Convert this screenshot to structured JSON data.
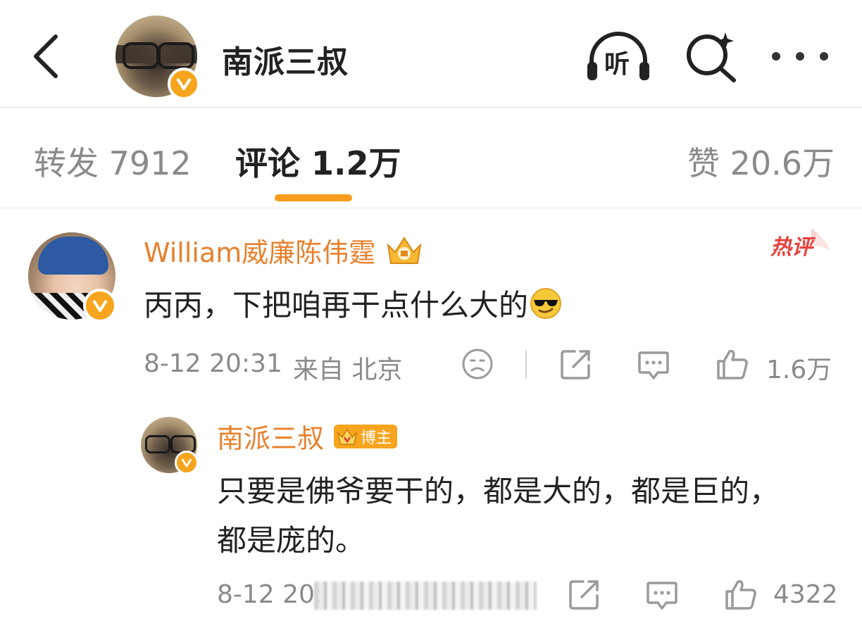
{
  "header": {
    "back_icon": "chevron-left-icon",
    "name": "南派三叔",
    "listen_label": "听",
    "search_icon": "search-sparkle-icon",
    "more_icon": "more-horizontal-icon"
  },
  "tabs": [
    {
      "label": "转发 7912",
      "active": false
    },
    {
      "label": "评论 1.2万",
      "active": true
    },
    {
      "label": "赞 20.6万",
      "active": false
    }
  ],
  "accent_color": "#f79b1e",
  "comments": [
    {
      "username": "William威廉陈伟霆",
      "badge_icon": "crown-fan-badge-icon",
      "hot_tag": "热评",
      "text": "丙丙，下把咱再干点什么大的",
      "emoji_icon": "sunglasses-emoji-icon",
      "time": "8-12 20:31",
      "location": "来自 北京",
      "like_count": "1.6万",
      "reply": {
        "username": "南派三叔",
        "badge_label": "博主",
        "text_line1": "只要是佛爷要干的，都是大的，都是巨的，",
        "text_line2": "都是庞的。",
        "time_partial": "8-12 20:",
        "like_count": "4322"
      }
    }
  ]
}
